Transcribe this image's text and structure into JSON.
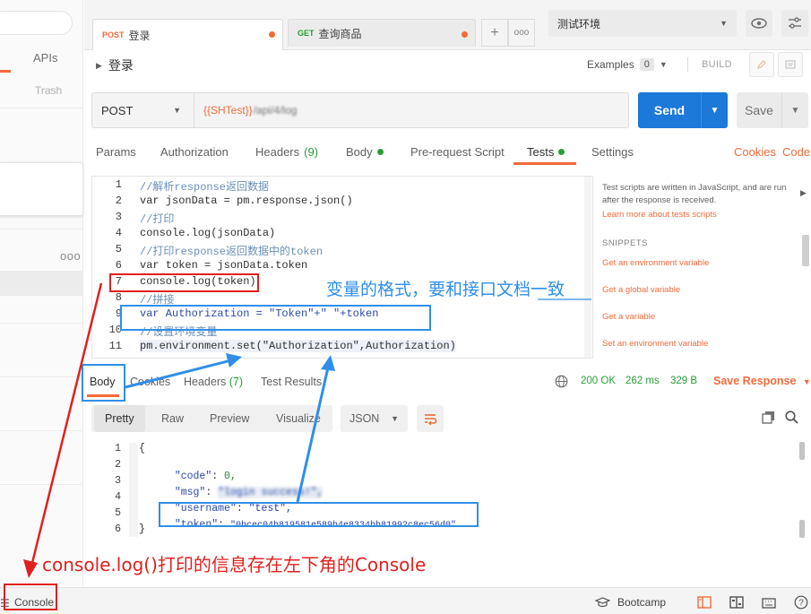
{
  "sidebar": {
    "tab_apis": "APIs",
    "trash": "Trash",
    "more": "ooo"
  },
  "tabs": [
    {
      "method": "POST",
      "name": "登录",
      "method_color": "#f26b3a"
    },
    {
      "method": "GET",
      "name": "查询商品",
      "method_color": "#26a035"
    }
  ],
  "tabs_more": "ooo",
  "environment": "测试环境",
  "request": {
    "title": "登录",
    "examples_label": "Examples",
    "examples_count": "0",
    "build_label": "BUILD",
    "method": "POST",
    "url_var": "{{SHTest}}",
    "url_rest": "/api/4/log",
    "send_label": "Send",
    "save_label": "Save"
  },
  "request_tabs": {
    "params": "Params",
    "authorization": "Authorization",
    "headers": "Headers",
    "headers_count": "(9)",
    "body": "Body",
    "prerequest": "Pre-request Script",
    "tests": "Tests",
    "settings": "Settings",
    "cookies": "Cookies",
    "code": "Code"
  },
  "editor": {
    "line_numbers": [
      "1",
      "2",
      "3",
      "4",
      "5",
      "6",
      "7",
      "8",
      "9",
      "10",
      "11"
    ],
    "lines": [
      "//解析response返回数据",
      "var jsonData = pm.response.json()",
      "//打印",
      "console.log(jsonData)",
      "//打印response返回数据中的token",
      "var token = jsonData.token",
      "console.log(token)",
      "//拼接",
      "var Authorization = \"Token\"+\" \"+token",
      "//设置环境变量",
      "pm.environment.set(\"Authorization\",Authorization)"
    ]
  },
  "snippets": {
    "hint": "Test scripts are written in JavaScript, and are run after the response is received.",
    "learn_more": "Learn more about tests scripts",
    "heading": "SNIPPETS",
    "items": [
      "Get an environment variable",
      "Get a global variable",
      "Get a variable",
      "Set an environment variable"
    ]
  },
  "response": {
    "tabs": {
      "body": "Body",
      "cookies": "Cookies",
      "headers": "Headers",
      "headers_count": "(7)",
      "test_results": "Test Results"
    },
    "status": "200 OK",
    "time": "262 ms",
    "size": "329 B",
    "save_response": "Save Response",
    "formats": [
      "Pretty",
      "Raw",
      "Preview",
      "Visualize"
    ],
    "language": "JSON",
    "line_numbers": [
      "1",
      "2",
      "3",
      "4",
      "5",
      "6"
    ],
    "json": {
      "open": "{",
      "close": "}",
      "code_key": "\"code\"",
      "code_val": "0,",
      "msg_key": "\"msg\"",
      "msg_val": "\"login success!\",",
      "user_key": "\"username\"",
      "user_val": "\"test\",",
      "token_key": "\"token\"",
      "token_val": "\"0bcec04b819581e589b4e8334bb81992c8ec56d0\""
    }
  },
  "statusbar": {
    "console": "Console",
    "bootcamp": "Bootcamp"
  },
  "annotations": {
    "variable_note": "变量的格式，要和接口文档一致",
    "console_note": "console.log()打印的信息存在左下角的Console"
  },
  "colors": {
    "accent": "#f26b3a",
    "send": "#1c78d9",
    "success": "#26a035",
    "annotation_red": "#e0211d",
    "annotation_blue": "#2f8fe8"
  }
}
